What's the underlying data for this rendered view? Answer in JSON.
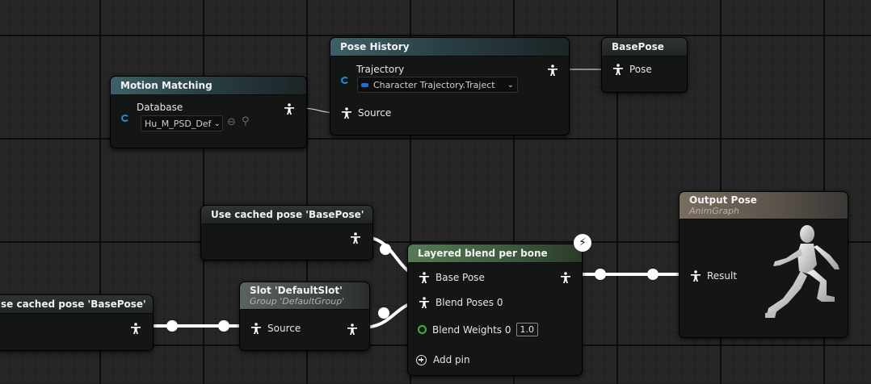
{
  "nodes": {
    "motion_matching": {
      "title": "Motion Matching",
      "database_label": "Database",
      "database_value": "Hu_M_PSD_Def"
    },
    "pose_history": {
      "title": "Pose History",
      "trajectory_label": "Trajectory",
      "trajectory_value": "Character Trajectory.Traject",
      "source_label": "Source"
    },
    "base_pose": {
      "title": "BasePose",
      "pose_label": "Pose"
    },
    "use_cached_1": {
      "title": "Use cached pose 'BasePose'"
    },
    "use_cached_2": {
      "title": "se cached pose 'BasePose'"
    },
    "slot": {
      "title": "Slot 'DefaultSlot'",
      "subtitle": "Group 'DefaultGroup'",
      "source_label": "Source"
    },
    "layered_blend": {
      "title": "Layered blend per bone",
      "base_pose_label": "Base Pose",
      "blend_poses_label": "Blend Poses 0",
      "blend_weights_label": "Blend Weights 0",
      "blend_weights_value": "1.0",
      "add_pin_label": "Add pin"
    },
    "output_pose": {
      "title": "Output Pose",
      "subtitle": "AnimGraph",
      "result_label": "Result"
    }
  },
  "colors": {
    "pose_wire": "#ffffff",
    "object_pin": "#1f8fe0",
    "float_pin": "#3cb43c",
    "header_teal": "#3d6068",
    "header_green": "#557a55",
    "header_output": "#7a6e60"
  },
  "icons": [
    "pose-icon",
    "object-pin-icon",
    "float-pin-icon",
    "browse-icon",
    "search-icon",
    "chevron-down-icon",
    "add-pin-icon",
    "fast-path-icon",
    "mannequin-icon"
  ]
}
